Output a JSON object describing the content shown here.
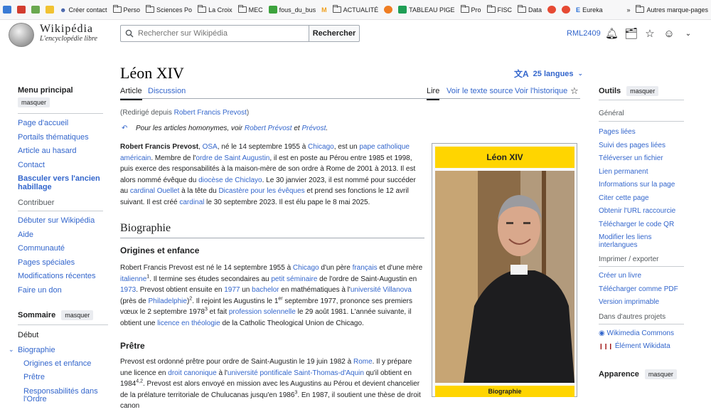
{
  "bookmarks": [
    {
      "icon": "colored-square",
      "label": ""
    },
    {
      "icon": "colored-square",
      "label": ""
    },
    {
      "icon": "colored-square",
      "label": ""
    },
    {
      "icon": "colored-square",
      "label": ""
    },
    {
      "icon": "user-icon",
      "label": "Créer contact"
    },
    {
      "icon": "folder-icon",
      "label": "Perso"
    },
    {
      "icon": "folder-icon",
      "label": "Sciences Po"
    },
    {
      "icon": "folder-icon",
      "label": "La Croix"
    },
    {
      "icon": "folder-icon",
      "label": "MEC"
    },
    {
      "icon": "green-d-icon",
      "label": "fous_du_bus"
    },
    {
      "icon": "m-icon",
      "label": ""
    },
    {
      "icon": "folder-icon",
      "label": "ACTUALITÉ"
    },
    {
      "icon": "orange-icon",
      "label": ""
    },
    {
      "icon": "plus-icon",
      "label": "TABLEAU PIGE"
    },
    {
      "icon": "folder-icon",
      "label": "Pro"
    },
    {
      "icon": "folder-icon",
      "label": "FISC"
    },
    {
      "icon": "folder-icon",
      "label": "Data"
    },
    {
      "icon": "red-icon",
      "label": ""
    },
    {
      "icon": "red-icon",
      "label": ""
    },
    {
      "icon": "e-icon",
      "label": "Eureka"
    },
    {
      "icon": "chevron-icon",
      "label": "»"
    },
    {
      "icon": "folder-icon",
      "label": "Autres marque-pages"
    }
  ],
  "header": {
    "logo_word": "Wikipédia",
    "logo_tagline": "L'encyclopédie libre",
    "search_placeholder": "Rechercher sur Wikipédia",
    "search_button": "Rechercher",
    "username": "RML2409"
  },
  "left_nav": {
    "title": "Menu principal",
    "hide_label": "masquer",
    "items": [
      "Page d'accueil",
      "Portails thématiques",
      "Article au hasard",
      "Contact",
      "Basculer vers l'ancien habillage"
    ],
    "contribute_heading": "Contribuer",
    "contribute_items": [
      "Débuter sur Wikipédia",
      "Aide",
      "Communauté",
      "Pages spéciales",
      "Modifications récentes",
      "Faire un don"
    ]
  },
  "toc": {
    "title": "Sommaire",
    "hide_label": "masquer",
    "items": [
      "Début",
      "Biographie",
      "Origines et enfance",
      "Prêtre",
      "Responsabilités dans l'Ordre"
    ]
  },
  "article": {
    "title": "Léon XIV",
    "languages": "25 langues",
    "tab_article": "Article",
    "tab_discussion": "Discussion",
    "tab_read": "Lire",
    "tab_source": "Voir le texte source",
    "tab_history": "Voir l'historique",
    "redirect_prefix": "(Redirigé depuis ",
    "redirect_link": "Robert Francis Prevost",
    "redirect_suffix": ")",
    "hatnote_prefix": "Pour les articles homonymes, voir ",
    "hatnote_link1": "Robert Prévost",
    "hatnote_mid": " et ",
    "hatnote_link2": "Prévost",
    "hatnote_end": ".",
    "section_bio": "Biographie",
    "sub_origins": "Origines et enfance",
    "sub_priest": "Prêtre"
  },
  "infobox": {
    "title": "Léon XIV",
    "section": "Biographie"
  },
  "right_nav": {
    "title": "Outils",
    "hide_label": "masquer",
    "general": "Général",
    "items": [
      "Pages liées",
      "Suivi des pages liées",
      "Téléverser un fichier",
      "Lien permanent",
      "Informations sur la page",
      "Citer cette page",
      "Obtenir l'URL raccourcie",
      "Télécharger le code QR",
      "Modifier les liens interlangues"
    ],
    "print_heading": "Imprimer / exporter",
    "print_items": [
      "Créer un livre",
      "Télécharger comme PDF",
      "Version imprimable"
    ],
    "projects_heading": "Dans d'autres projets",
    "projects": [
      "Wikimedia Commons",
      "Élément Wikidata"
    ],
    "appearance": "Apparence",
    "appearance_hide": "masquer"
  },
  "colors": {
    "link": "#3366cc",
    "infobox_gold": "#ffd500",
    "border": "#a2a9b1"
  }
}
